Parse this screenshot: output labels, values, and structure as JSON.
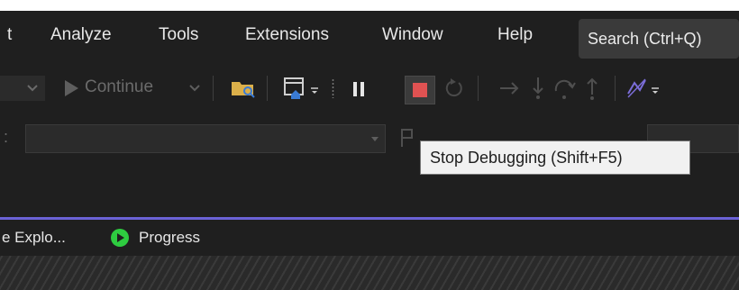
{
  "menu": {
    "items": [
      {
        "label": "t"
      },
      {
        "label": "Analyze"
      },
      {
        "label": "Tools"
      },
      {
        "label": "Extensions"
      },
      {
        "label": "Window"
      },
      {
        "label": "Help"
      }
    ],
    "search_placeholder": "Search (Ctrl+Q)"
  },
  "toolbar": {
    "continue_label": "Continue",
    "stop_color": "#e05252"
  },
  "tooltip": {
    "text": "Stop Debugging (Shift+F5)"
  },
  "tabs": {
    "explorer_label": "e Explo...",
    "progress_label": "Progress"
  },
  "colors": {
    "accent_purple": "#6b62d6",
    "progress_green": "#2ecc40"
  }
}
